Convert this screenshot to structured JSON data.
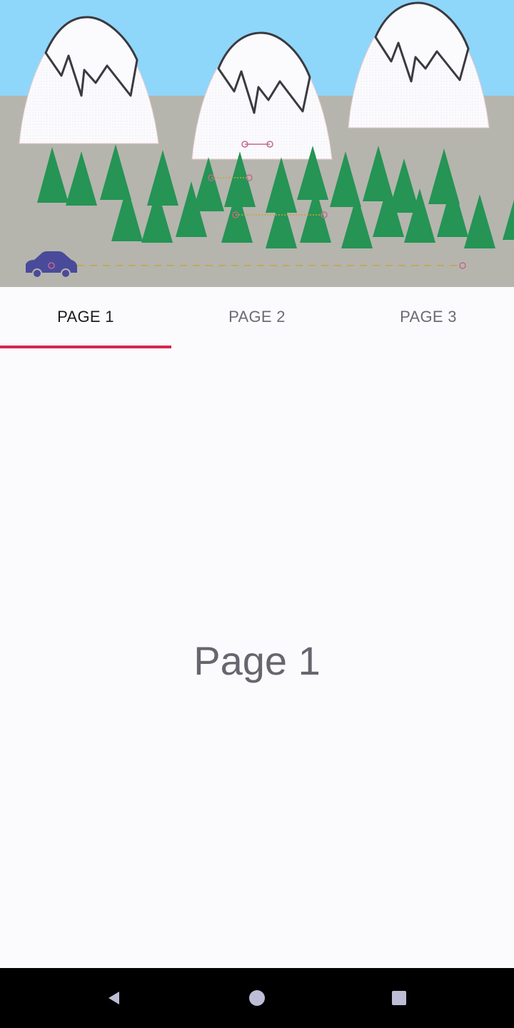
{
  "tabs": [
    {
      "label": "PAGE 1",
      "selected": true
    },
    {
      "label": "PAGE 2",
      "selected": false
    },
    {
      "label": "PAGE 3",
      "selected": false
    }
  ],
  "content": {
    "page_label": "Page 1"
  },
  "colors": {
    "sky": "#8fd6fb",
    "ground": "#b5b5ae",
    "tree": "#259454",
    "car": "#4a4a9b",
    "tab_indicator": "#d6284f",
    "nav_bar": "#000000",
    "nav_icon": "#bdbdd6"
  },
  "header_scene": {
    "icons": [
      "mountain-icon",
      "tree-icon",
      "car-icon",
      "motion-path-handle-icon"
    ]
  },
  "nav_bar": {
    "buttons": [
      "back-icon",
      "home-icon",
      "recents-icon"
    ]
  }
}
